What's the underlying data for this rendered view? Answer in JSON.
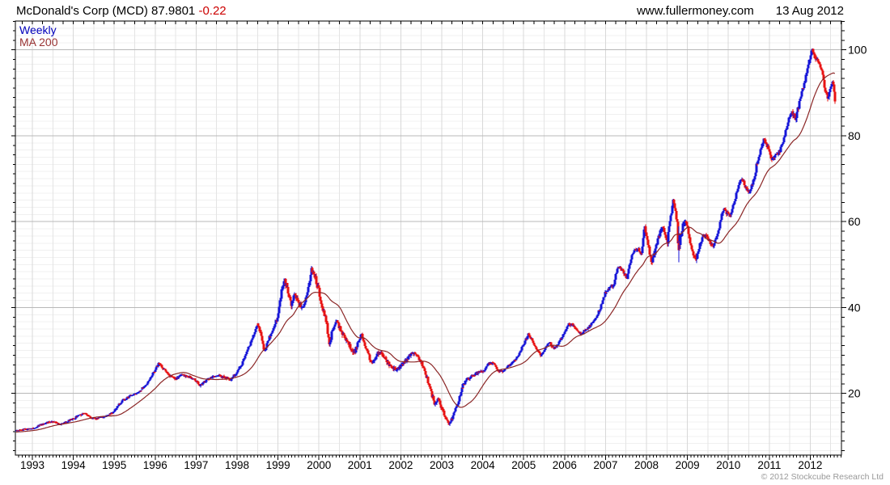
{
  "header": {
    "title": "McDonald's Corp (MCD) 87.9801 ",
    "change": "-0.22",
    "site": "www.fullermoney.com",
    "date": "13 Aug 2012"
  },
  "legend": {
    "weekly_label": "Weekly",
    "ma_label": "MA 200"
  },
  "footer": {
    "copyright": "© 2012 Stockcube Research Ltd"
  },
  "colors": {
    "up_bar": "#1515d8",
    "down_bar": "#e81212",
    "ma_line": "#8b2626",
    "weekly_text": "#0000bb",
    "ma_text": "#993333",
    "change_text": "#cc0000",
    "copyright_text": "#999999",
    "grid_minor_h": "#f0f0f0",
    "grid_half_year": "#e4e4e4",
    "grid_year": "#d8d8d8",
    "grid_major_h": "#b8b8b8",
    "axis": "#000000"
  },
  "chart_data": {
    "type": "candlestick-weekly",
    "title": "McDonald's Corp (MCD)",
    "last_price": 87.9801,
    "change": -0.22,
    "as_of": "13 Aug 2012",
    "legend": [
      "Weekly",
      "MA 200"
    ],
    "ma_window_weeks": 40,
    "x_tick_years": [
      1993,
      1994,
      1995,
      1996,
      1997,
      1998,
      1999,
      2000,
      2001,
      2002,
      2003,
      2004,
      2005,
      2006,
      2007,
      2008,
      2009,
      2010,
      2011,
      2012
    ],
    "y_ticks": [
      20,
      40,
      60,
      80,
      100
    ],
    "x_range": [
      1992.585,
      2012.762
    ],
    "y_range": [
      5.64,
      106.72
    ],
    "week_step_years": 0.019231,
    "data_start": 1992.6,
    "data_end": 2012.617,
    "anchors_format": [
      "decimal_year",
      "close",
      "typical_weekly_range"
    ],
    "anchors": [
      [
        1992.6,
        11.3,
        0.45
      ],
      [
        1992.8,
        11.7,
        0.45
      ],
      [
        1993.0,
        11.9,
        0.5
      ],
      [
        1993.1,
        12.2,
        0.5
      ],
      [
        1993.2,
        12.7,
        0.5
      ],
      [
        1993.4,
        13.4,
        0.5
      ],
      [
        1993.55,
        13.5,
        0.5
      ],
      [
        1993.68,
        12.7,
        0.5
      ],
      [
        1993.8,
        13.3,
        0.55
      ],
      [
        1994.0,
        14.1,
        0.6
      ],
      [
        1994.15,
        15.0,
        0.6
      ],
      [
        1994.28,
        15.4,
        0.55
      ],
      [
        1994.42,
        14.4,
        0.55
      ],
      [
        1994.55,
        14.1,
        0.5
      ],
      [
        1994.7,
        14.5,
        0.5
      ],
      [
        1994.85,
        15.0,
        0.5
      ],
      [
        1995.0,
        15.8,
        0.55
      ],
      [
        1995.1,
        17.2,
        0.6
      ],
      [
        1995.2,
        18.3,
        0.6
      ],
      [
        1995.35,
        19.2,
        0.6
      ],
      [
        1995.5,
        19.9,
        0.6
      ],
      [
        1995.65,
        20.8,
        0.6
      ],
      [
        1995.8,
        22.3,
        0.65
      ],
      [
        1995.95,
        24.7,
        0.75
      ],
      [
        1996.08,
        26.9,
        0.9
      ],
      [
        1996.2,
        25.7,
        0.8
      ],
      [
        1996.35,
        24.3,
        0.75
      ],
      [
        1996.5,
        23.4,
        0.7
      ],
      [
        1996.65,
        24.3,
        0.7
      ],
      [
        1996.8,
        24.0,
        0.7
      ],
      [
        1996.95,
        23.3,
        0.7
      ],
      [
        1997.1,
        21.9,
        0.75
      ],
      [
        1997.25,
        23.0,
        0.7
      ],
      [
        1997.4,
        23.8,
        0.7
      ],
      [
        1997.55,
        24.3,
        0.7
      ],
      [
        1997.7,
        23.7,
        0.7
      ],
      [
        1997.85,
        23.2,
        0.7
      ],
      [
        1998.0,
        24.9,
        0.8
      ],
      [
        1998.12,
        26.9,
        0.85
      ],
      [
        1998.25,
        30.0,
        0.95
      ],
      [
        1998.38,
        33.1,
        1.05
      ],
      [
        1998.5,
        36.4,
        1.15
      ],
      [
        1998.58,
        34.2,
        1.15
      ],
      [
        1998.68,
        29.6,
        1.25
      ],
      [
        1998.8,
        33.4,
        1.25
      ],
      [
        1998.92,
        36.2,
        1.3
      ],
      [
        1999.0,
        38.2,
        1.5
      ],
      [
        1999.08,
        44.0,
        2.0
      ],
      [
        1999.16,
        46.2,
        1.9
      ],
      [
        1999.25,
        43.9,
        1.8
      ],
      [
        1999.33,
        40.5,
        1.7
      ],
      [
        1999.42,
        43.2,
        1.6
      ],
      [
        1999.5,
        41.5,
        1.6
      ],
      [
        1999.58,
        39.8,
        1.6
      ],
      [
        1999.66,
        41.5,
        1.5
      ],
      [
        1999.74,
        44.5,
        1.6
      ],
      [
        1999.82,
        49.1,
        2.1
      ],
      [
        1999.9,
        47.1,
        1.9
      ],
      [
        2000.0,
        44.3,
        1.9
      ],
      [
        2000.08,
        40.3,
        1.9
      ],
      [
        2000.17,
        37.6,
        1.8
      ],
      [
        2000.26,
        31.5,
        1.9
      ],
      [
        2000.34,
        35.4,
        1.7
      ],
      [
        2000.42,
        37.3,
        1.6
      ],
      [
        2000.5,
        35.3,
        1.5
      ],
      [
        2000.6,
        33.3,
        1.5
      ],
      [
        2000.7,
        32.3,
        1.45
      ],
      [
        2000.8,
        30.3,
        1.4
      ],
      [
        2000.88,
        29.7,
        1.4
      ],
      [
        2000.96,
        32.4,
        1.4
      ],
      [
        2001.04,
        33.6,
        1.4
      ],
      [
        2001.14,
        30.9,
        1.35
      ],
      [
        2001.24,
        27.9,
        1.3
      ],
      [
        2001.34,
        27.3,
        1.25
      ],
      [
        2001.44,
        29.6,
        1.2
      ],
      [
        2001.54,
        29.2,
        1.15
      ],
      [
        2001.64,
        27.9,
        1.15
      ],
      [
        2001.76,
        26.1,
        1.25
      ],
      [
        2001.9,
        25.7,
        1.2
      ],
      [
        2002.0,
        26.4,
        1.15
      ],
      [
        2002.1,
        27.3,
        1.1
      ],
      [
        2002.22,
        28.9,
        1.1
      ],
      [
        2002.32,
        29.3,
        1.1
      ],
      [
        2002.42,
        28.5,
        1.05
      ],
      [
        2002.54,
        26.4,
        1.1
      ],
      [
        2002.64,
        23.4,
        1.25
      ],
      [
        2002.74,
        19.9,
        1.35
      ],
      [
        2002.84,
        17.3,
        1.35
      ],
      [
        2002.92,
        18.7,
        1.25
      ],
      [
        2003.02,
        16.1,
        1.15
      ],
      [
        2003.12,
        13.9,
        1.0
      ],
      [
        2003.2,
        12.9,
        0.95
      ],
      [
        2003.3,
        15.6,
        0.95
      ],
      [
        2003.4,
        18.1,
        0.95
      ],
      [
        2003.5,
        21.6,
        0.95
      ],
      [
        2003.62,
        23.2,
        0.9
      ],
      [
        2003.75,
        24.2,
        0.85
      ],
      [
        2003.9,
        25.0,
        0.8
      ],
      [
        2004.02,
        25.4,
        0.8
      ],
      [
        2004.14,
        26.9,
        0.8
      ],
      [
        2004.26,
        27.2,
        0.75
      ],
      [
        2004.38,
        25.3,
        0.75
      ],
      [
        2004.5,
        25.1,
        0.7
      ],
      [
        2004.62,
        26.4,
        0.7
      ],
      [
        2004.75,
        27.4,
        0.7
      ],
      [
        2004.88,
        29.2,
        0.75
      ],
      [
        2005.0,
        31.3,
        0.85
      ],
      [
        2005.12,
        33.7,
        0.9
      ],
      [
        2005.22,
        32.3,
        0.85
      ],
      [
        2005.32,
        30.3,
        0.8
      ],
      [
        2005.42,
        28.7,
        0.8
      ],
      [
        2005.52,
        30.4,
        0.75
      ],
      [
        2005.62,
        31.9,
        0.75
      ],
      [
        2005.75,
        30.4,
        0.75
      ],
      [
        2005.88,
        32.0,
        0.8
      ],
      [
        2006.0,
        34.4,
        0.9
      ],
      [
        2006.1,
        36.0,
        0.9
      ],
      [
        2006.18,
        36.2,
        0.85
      ],
      [
        2006.28,
        34.9,
        0.8
      ],
      [
        2006.4,
        33.9,
        0.8
      ],
      [
        2006.52,
        34.8,
        0.8
      ],
      [
        2006.64,
        35.9,
        0.8
      ],
      [
        2006.76,
        37.4,
        0.85
      ],
      [
        2006.88,
        40.2,
        0.95
      ],
      [
        2007.0,
        43.9,
        1.05
      ],
      [
        2007.1,
        44.7,
        1.05
      ],
      [
        2007.2,
        45.0,
        1.05
      ],
      [
        2007.3,
        49.6,
        1.15
      ],
      [
        2007.4,
        48.9,
        1.1
      ],
      [
        2007.52,
        46.9,
        1.15
      ],
      [
        2007.62,
        51.4,
        1.2
      ],
      [
        2007.72,
        53.5,
        1.25
      ],
      [
        2007.8,
        53.9,
        1.25
      ],
      [
        2007.88,
        52.1,
        1.3
      ],
      [
        2007.96,
        59.4,
        1.6
      ],
      [
        2008.04,
        55.1,
        1.7
      ],
      [
        2008.12,
        50.4,
        1.65
      ],
      [
        2008.22,
        53.6,
        1.55
      ],
      [
        2008.32,
        57.3,
        1.5
      ],
      [
        2008.4,
        58.9,
        1.5
      ],
      [
        2008.5,
        54.5,
        1.6
      ],
      [
        2008.58,
        60.1,
        1.7
      ],
      [
        2008.66,
        64.9,
        1.95
      ],
      [
        2008.72,
        62.6,
        2.2
      ],
      [
        2008.76,
        58.6,
        2.6
      ],
      [
        2008.785,
        53.2,
        13.5
      ],
      [
        2008.82,
        55.6,
        3.0
      ],
      [
        2008.88,
        58.7,
        2.6
      ],
      [
        2008.97,
        59.6,
        2.1
      ],
      [
        2009.06,
        55.4,
        1.9
      ],
      [
        2009.14,
        52.4,
        1.8
      ],
      [
        2009.21,
        50.9,
        1.7
      ],
      [
        2009.3,
        54.2,
        1.5
      ],
      [
        2009.4,
        56.9,
        1.4
      ],
      [
        2009.5,
        55.9,
        1.35
      ],
      [
        2009.62,
        54.4,
        1.3
      ],
      [
        2009.74,
        57.2,
        1.3
      ],
      [
        2009.86,
        62.8,
        1.35
      ],
      [
        2009.95,
        62.3,
        1.3
      ],
      [
        2010.04,
        61.4,
        1.3
      ],
      [
        2010.13,
        63.9,
        1.25
      ],
      [
        2010.22,
        67.2,
        1.25
      ],
      [
        2010.32,
        70.4,
        1.3
      ],
      [
        2010.42,
        67.9,
        1.3
      ],
      [
        2010.5,
        66.5,
        1.3
      ],
      [
        2010.6,
        69.4,
        1.25
      ],
      [
        2010.7,
        73.3,
        1.25
      ],
      [
        2010.8,
        76.8,
        1.3
      ],
      [
        2010.88,
        79.2,
        1.4
      ],
      [
        2010.96,
        77.4,
        1.35
      ],
      [
        2011.05,
        74.4,
        1.35
      ],
      [
        2011.15,
        75.3,
        1.3
      ],
      [
        2011.25,
        76.4,
        1.3
      ],
      [
        2011.35,
        79.3,
        1.3
      ],
      [
        2011.46,
        83.0,
        1.4
      ],
      [
        2011.55,
        85.9,
        1.55
      ],
      [
        2011.65,
        84.0,
        1.85
      ],
      [
        2011.75,
        88.4,
        1.7
      ],
      [
        2011.85,
        91.9,
        1.6
      ],
      [
        2011.95,
        96.9,
        1.7
      ],
      [
        2012.03,
        100.2,
        1.8
      ],
      [
        2012.1,
        98.9,
        1.6
      ],
      [
        2012.18,
        97.4,
        1.5
      ],
      [
        2012.27,
        96.1,
        1.5
      ],
      [
        2012.35,
        91.4,
        1.6
      ],
      [
        2012.43,
        88.3,
        1.6
      ],
      [
        2012.5,
        91.7,
        1.5
      ],
      [
        2012.55,
        93.0,
        1.45
      ],
      [
        2012.617,
        87.98,
        1.4
      ]
    ]
  }
}
